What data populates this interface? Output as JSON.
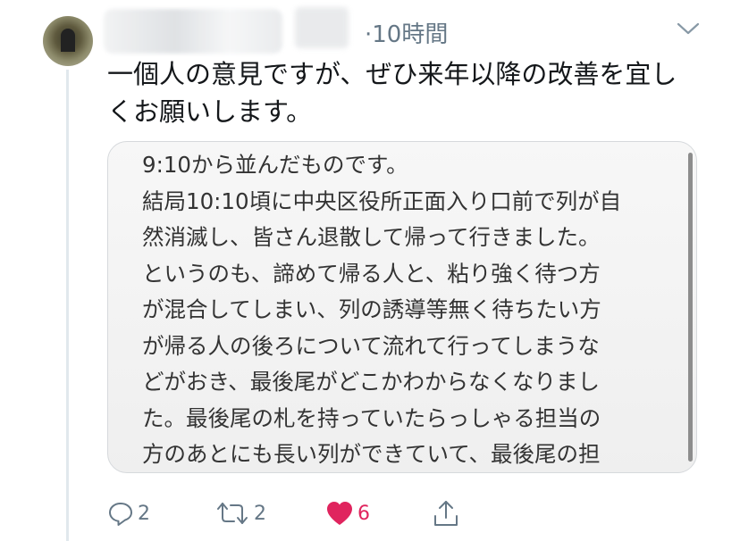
{
  "tweet": {
    "time": "10時間",
    "text_lines": [
      "一個人の意見ですが、ぜひ来年以降の改善を宜し",
      "くお願いします。"
    ],
    "image_text_lines": [
      "9:10から並んだものです。",
      "結局10:10頃に中央区役所正面入り口前で列が自",
      "然消滅し、皆さん退散して帰って行きました。",
      "というのも、諦めて帰る人と、粘り強く待つ方",
      "が混合してしまい、列の誘導等無く待ちたい方",
      "が帰る人の後ろについて流れて行ってしまうな",
      "どがおき、最後尾がどこかわからなくなりまし",
      "た。最後尾の札を持っていたらっしゃる担当の",
      "方のあとにも長い列ができていて、最後尾の担"
    ]
  },
  "actions": {
    "reply_count": "2",
    "retweet_count": "2",
    "like_count": "6"
  },
  "icons": {
    "reply": "reply-icon",
    "retweet": "retweet-icon",
    "like": "heart-icon",
    "share": "share-icon",
    "menu": "chevron-down-icon"
  },
  "colors": {
    "like": "#e0245e",
    "meta": "#657786"
  }
}
